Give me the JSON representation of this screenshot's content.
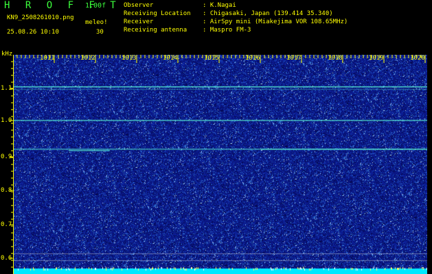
{
  "header": {
    "app_title": "H R O F F T",
    "version": "1.00f",
    "file_name": "KN9_2508261010.png",
    "meleo_label": "meleo!",
    "datetime": "25.08.26 10:10",
    "count": "30",
    "info_rows": [
      {
        "label": "Observer",
        "value": "K.Nagai"
      },
      {
        "label": "Receiving Location",
        "value": "Chigasaki, Japan (139.414 35.340)"
      },
      {
        "label": "Receiver",
        "value": "AirSpy mini (Miakejima VOR 108.65MHz)"
      },
      {
        "label": "Receiving antenna",
        "value": "Maspro FM-3"
      }
    ]
  },
  "waterfall": {
    "y_unit": "kHz",
    "y_ticks": [
      "1.1",
      "1.0",
      "0.9",
      "0.8",
      "0.7",
      "0.6"
    ],
    "x_ticks": [
      "1011",
      "1012",
      "1013",
      "1014",
      "1015",
      "1016",
      "1017",
      "1018",
      "1019",
      "1020"
    ],
    "bg_color": "#0a1a8c",
    "signal_color": "#5cffd8",
    "baseline_color": "#00e8ff"
  }
}
